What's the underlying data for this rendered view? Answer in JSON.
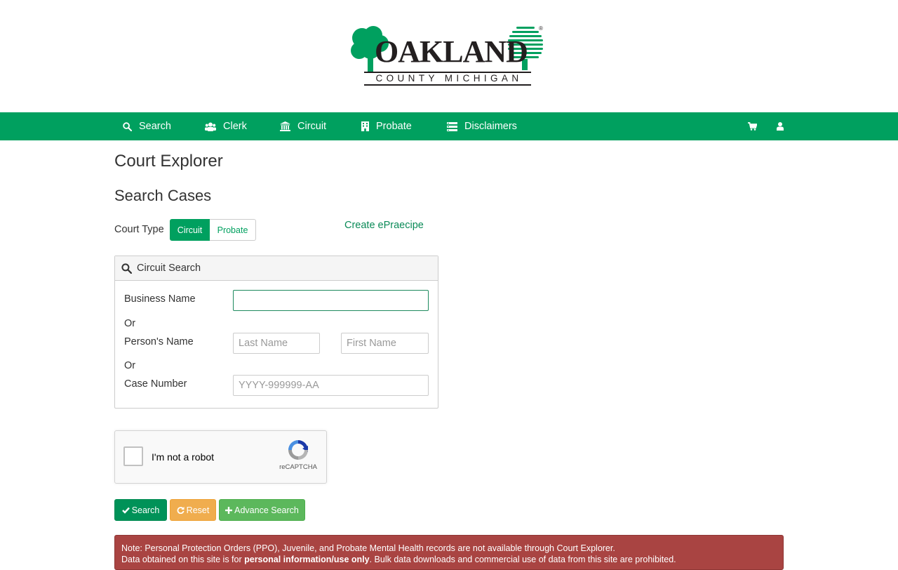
{
  "brand": {
    "logo_text": "OAKLAND",
    "logo_sub": "COUNTY MICHIGAN",
    "registered_mark": "®",
    "color": "#00a05f"
  },
  "nav": {
    "items": [
      {
        "label": "Search",
        "icon": "search-icon"
      },
      {
        "label": "Clerk",
        "icon": "users-icon"
      },
      {
        "label": "Circuit",
        "icon": "courthouse-icon"
      },
      {
        "label": "Probate",
        "icon": "building-icon"
      },
      {
        "label": "Disclaimers",
        "icon": "list-icon"
      }
    ],
    "right_icons": [
      "cart-icon",
      "user-icon"
    ]
  },
  "page": {
    "title": "Court Explorer",
    "section": "Search Cases"
  },
  "court_type": {
    "label": "Court Type",
    "options": [
      "Circuit",
      "Probate"
    ],
    "selected": "Circuit"
  },
  "epraecipe_link": "Create ePraecipe",
  "panel": {
    "title": "Circuit Search",
    "business_name_label": "Business Name",
    "business_name_value": "",
    "or_1": "Or",
    "person_name_label": "Person's Name",
    "last_name_placeholder": "Last Name",
    "first_name_placeholder": "First Name",
    "or_2": "Or",
    "case_number_label": "Case Number",
    "case_number_placeholder": "YYYY-999999-AA"
  },
  "recaptcha": {
    "label": "I'm not a robot",
    "brand": "reCAPTCHA"
  },
  "buttons": {
    "search": "Search",
    "reset": "Reset",
    "advance_search": "Advance Search"
  },
  "alert": {
    "line1": "Note: Personal Protection Orders (PPO), Juvenile, and Probate Mental Health records are not available through Court Explorer.",
    "line2_prefix": "Data obtained on this site is for ",
    "line2_bold": "personal information/use only",
    "line2_suffix": ". Bulk data downloads and commercial use of data from this site are prohibited."
  }
}
